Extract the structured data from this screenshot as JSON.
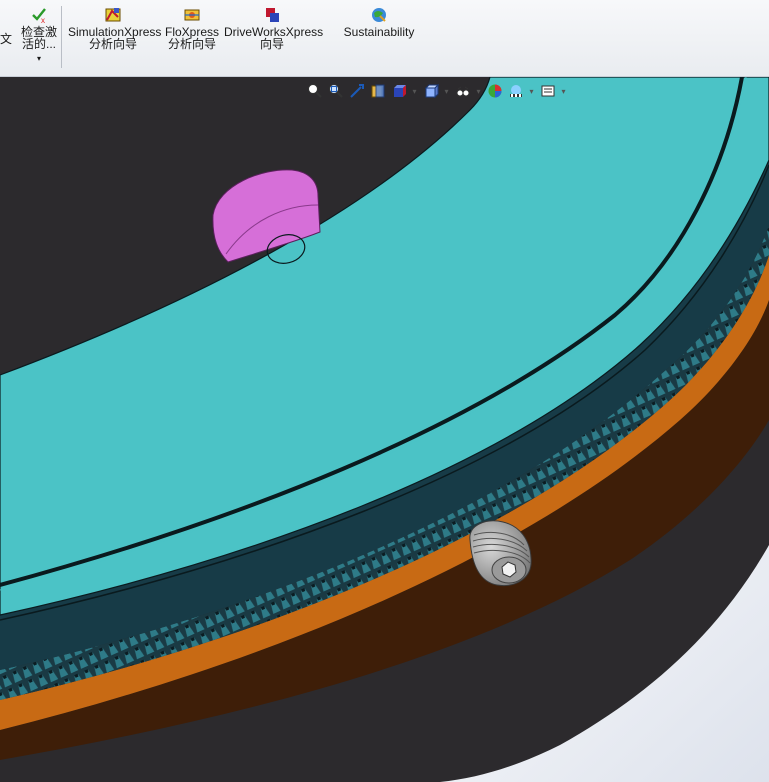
{
  "ribbon": {
    "items": [
      {
        "label1": "文",
        "label2": ""
      },
      {
        "label1": "检查激",
        "label2": "活的...",
        "dropdown": "▾"
      },
      {
        "label1": "SimulationXpress",
        "label2": "分析向导"
      },
      {
        "label1": "FloXpress",
        "label2": "分析向导"
      },
      {
        "label1": "DriveWorksXpress",
        "label2": "向导"
      },
      {
        "label1": "Sustainability",
        "label2": ""
      }
    ]
  },
  "view_toolbar": {
    "icons": [
      "zoom-to-fit-icon",
      "zoom-area-icon",
      "previous-view-icon",
      "section-view-icon",
      "view-orientation-icon",
      "display-style-icon",
      "hide-show-items-icon",
      "edit-appearance-icon",
      "apply-scene-icon",
      "view-settings-icon"
    ]
  },
  "colors": {
    "teal_flange": "#4bc3c6",
    "dark_teal_ring": "#173b47",
    "orange_ring": "#c86a14",
    "brown_ring": "#3e1e08",
    "black_body": "#2c2a2d",
    "pink_pin": "#d66fd8"
  }
}
